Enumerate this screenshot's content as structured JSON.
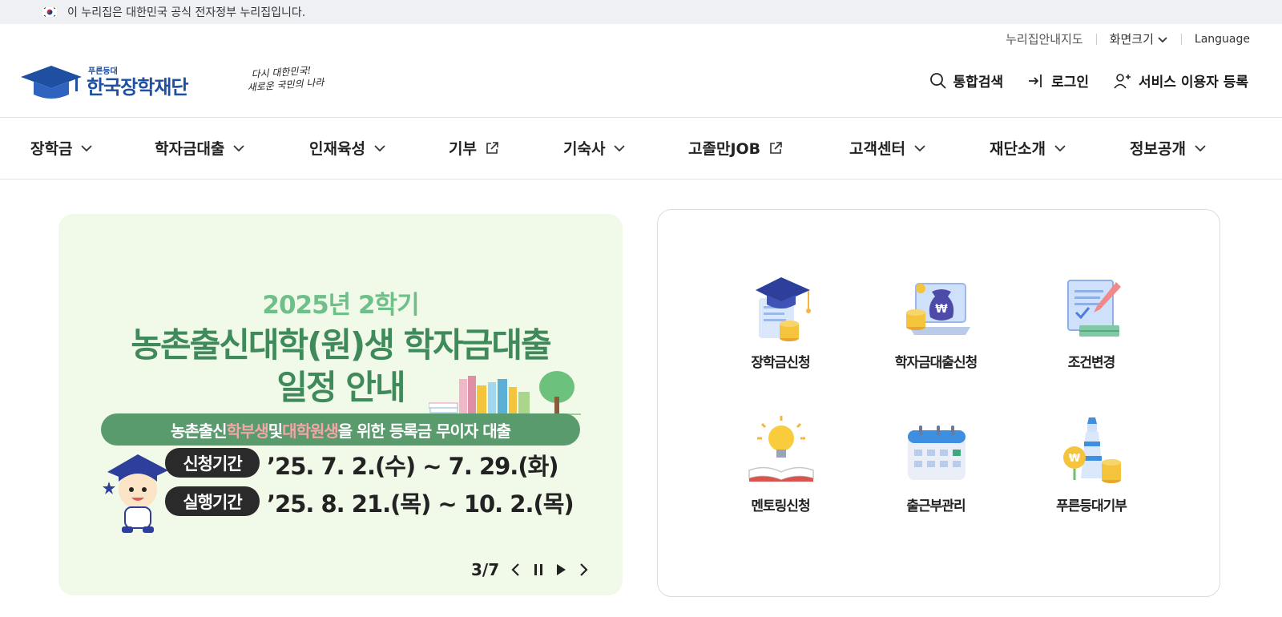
{
  "gov_banner": {
    "text": "이 누리집은 대한민국 공식 전자정부 누리집입니다."
  },
  "utility": {
    "sitemap": "누리집안내지도",
    "font_size": "화면크기",
    "language": "Language"
  },
  "logo": {
    "sub": "푸른등대",
    "main": "한국장학재단"
  },
  "slogan": {
    "line1": "다시 대한민국!",
    "line2": "새로운 국민의 나라"
  },
  "header_actions": {
    "search": "통합검색",
    "login": "로그인",
    "register": "서비스 이용자 등록"
  },
  "nav": [
    {
      "label": "장학금",
      "icon": "chevron-down-icon"
    },
    {
      "label": "학자금대출",
      "icon": "chevron-down-icon"
    },
    {
      "label": "인재육성",
      "icon": "chevron-down-icon"
    },
    {
      "label": "기부",
      "icon": "external-link-icon"
    },
    {
      "label": "기숙사",
      "icon": "chevron-down-icon"
    },
    {
      "label": "고졸만JOB",
      "icon": "external-link-icon"
    },
    {
      "label": "고객센터",
      "icon": "chevron-down-icon"
    },
    {
      "label": "재단소개",
      "icon": "chevron-down-icon"
    },
    {
      "label": "정보공개",
      "icon": "chevron-down-icon"
    }
  ],
  "hero": {
    "year": "2025년 2학기",
    "title1": "농촌출신대학(원)생 학자금대출",
    "title2": "일정 안내",
    "pill_a": "농촌출신 ",
    "pill_b": "학부생",
    "pill_c": " 및 ",
    "pill_d": "대학원생",
    "pill_e": "을 위한 등록금 무이자 대출",
    "apply_label": "신청기간",
    "apply_date": "’25. 7. 2.(수) ~ 7. 29.(화)",
    "exec_label": "실행기간",
    "exec_date": "’25. 8. 21.(목) ~ 10. 2.(목)",
    "pager": "3/7",
    "colors": {
      "bg": "#f1f9e8",
      "title": "#3f8a5a",
      "year": "#6fbf8a",
      "pill": "#5a9b6d"
    }
  },
  "quick_menu": [
    {
      "label": "장학금신청",
      "icon": "graduation-cap-icon"
    },
    {
      "label": "학자금대출신청",
      "icon": "money-bag-laptop-icon"
    },
    {
      "label": "조건변경",
      "icon": "document-pen-icon"
    },
    {
      "label": "멘토링신청",
      "icon": "lightbulb-book-icon"
    },
    {
      "label": "출근부관리",
      "icon": "calendar-icon"
    },
    {
      "label": "푸른등대기부",
      "icon": "lighthouse-coins-icon"
    }
  ]
}
